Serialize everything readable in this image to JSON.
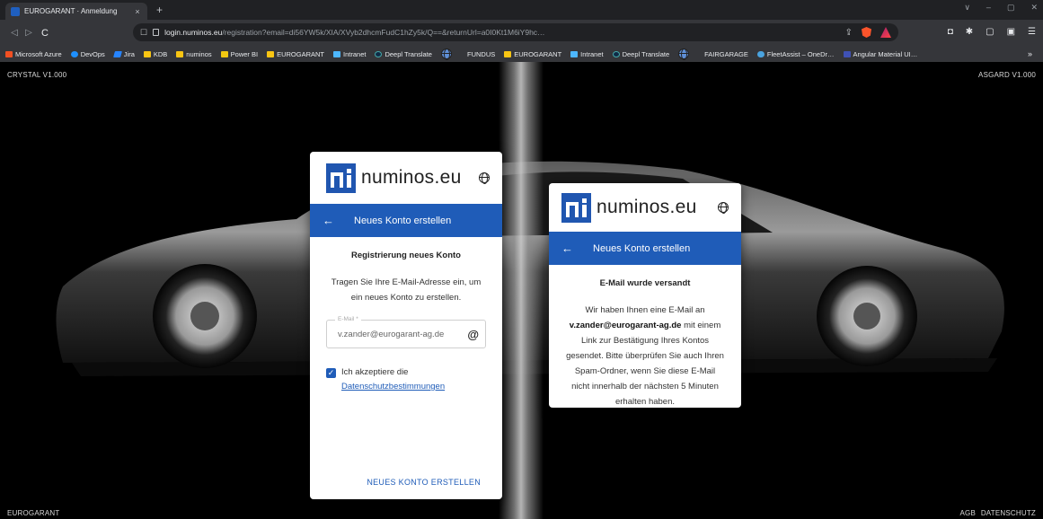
{
  "browser": {
    "tab_title": "EUROGARANT · Anmeldung",
    "tab_close": "×",
    "new_tab": "+",
    "window_controls": [
      "∨",
      "–",
      "▢",
      "✕"
    ],
    "url_host": "login.numinos.eu",
    "url_rest": "/registration?email=di56YW5k/XIA/XVyb2dhcmFudC1hZy5k/Q==&returnUrl=a0I0Kt1M6iY9hc…",
    "nav": {
      "back": "◁",
      "forward": "▷",
      "reload": "C"
    },
    "omnibox_icons": {
      "bookmark": "☐",
      "share": "⇪"
    },
    "extensions": [
      "◘",
      "✱",
      "▢",
      "▣",
      "☰"
    ]
  },
  "bookmarks": [
    {
      "label": "Microsoft Azure",
      "icon": "azure"
    },
    {
      "label": "DevOps",
      "icon": "devops"
    },
    {
      "label": "Jira",
      "icon": "jira"
    },
    {
      "label": "KDB",
      "icon": "folder"
    },
    {
      "label": "numinos",
      "icon": "folder"
    },
    {
      "label": "Power BI",
      "icon": "powerbi"
    },
    {
      "label": "EUROGARANT",
      "icon": "folder"
    },
    {
      "label": "Intranet",
      "icon": "intranet"
    },
    {
      "label": "Deepl Translate",
      "icon": "deepl"
    },
    {
      "label": "FUNDUS",
      "icon": "globe"
    },
    {
      "label": "EUROGARANT",
      "icon": "folder"
    },
    {
      "label": "Intranet",
      "icon": "intranet"
    },
    {
      "label": "Deepl Translate",
      "icon": "deepl"
    },
    {
      "label": "FAIRGARAGE",
      "icon": "globe"
    },
    {
      "label": "FleetAssist – OneDr…",
      "icon": "cloud"
    },
    {
      "label": "Angular Material UI…",
      "icon": "angular"
    }
  ],
  "bookmarks_more": "»",
  "page": {
    "top_left": "CRYSTAL V1.000",
    "top_right": "ASGARD V1.000",
    "bottom_left": "EUROGARANT",
    "footer_agb": "AGB",
    "footer_privacy": "DATENSCHUTZ"
  },
  "left_card": {
    "brand": "numinos.eu",
    "appbar_title": "Neues Konto erstellen",
    "back_icon": "←",
    "heading": "Registrierung neues Konto",
    "text": "Tragen Sie Ihre E-Mail-Adresse ein, um ein neues Konto zu erstellen.",
    "email_label": "E-Mail *",
    "email_value": "v.zander@eurogarant-ag.de",
    "at_icon": "@",
    "checkbox_mark": "✓",
    "accept_text": "Ich akzeptiere die",
    "accept_link": "Datenschutzbestimmungen",
    "submit_label": "NEUES KONTO ERSTELLEN"
  },
  "right_card": {
    "brand": "numinos.eu",
    "appbar_title": "Neues Konto erstellen",
    "back_icon": "←",
    "heading": "E-Mail wurde versandt",
    "text_before": "Wir haben Ihnen eine E-Mail an",
    "email": "v.zander@eurogarant-ag.de",
    "text_after": "mit einem Link zur Bestätigung Ihres Kontos gesendet. Bitte überprüfen Sie auch Ihren Spam-Ordner, wenn Sie diese E-Mail nicht innerhalb der nächsten 5 Minuten erhalten haben."
  }
}
